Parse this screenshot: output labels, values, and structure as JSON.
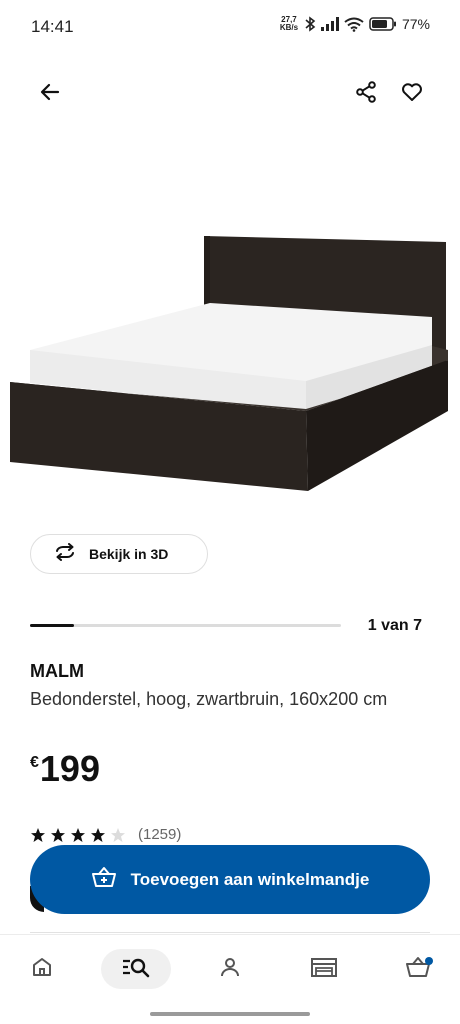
{
  "status_bar": {
    "time": "14:41",
    "net_speed_value": "27,7",
    "net_speed_unit": "KB/s",
    "battery_percent": "77%",
    "icons": [
      "bluetooth-icon",
      "signal-icon",
      "wifi-icon",
      "battery-icon"
    ]
  },
  "top_nav": {
    "icons": [
      "back-arrow-icon",
      "share-icon",
      "heart-icon"
    ]
  },
  "view_3d": {
    "label": "Bekijk in 3D",
    "icon": "rotate-3d-icon"
  },
  "pager": {
    "label": "1 van 7",
    "current": 1,
    "total": 7
  },
  "product": {
    "name": "MALM",
    "description": "Bedonderstel, hoog, zwartbruin, 160x200 cm",
    "currency": "€",
    "price": "199",
    "rating_value": 4,
    "rating_max": 5,
    "review_count": "(1259)"
  },
  "add_to_cart": {
    "label": "Toevoegen aan winkelmandje",
    "icon": "basket-add-icon"
  },
  "bottom_nav": {
    "items": [
      "home-icon",
      "search-icon",
      "profile-icon",
      "store-icon",
      "cart-icon"
    ],
    "active": "search"
  },
  "colors": {
    "primary": "#0058a3",
    "text": "#111111",
    "bed_frame": "#2a2420",
    "mattress": "#f5f5f5"
  }
}
